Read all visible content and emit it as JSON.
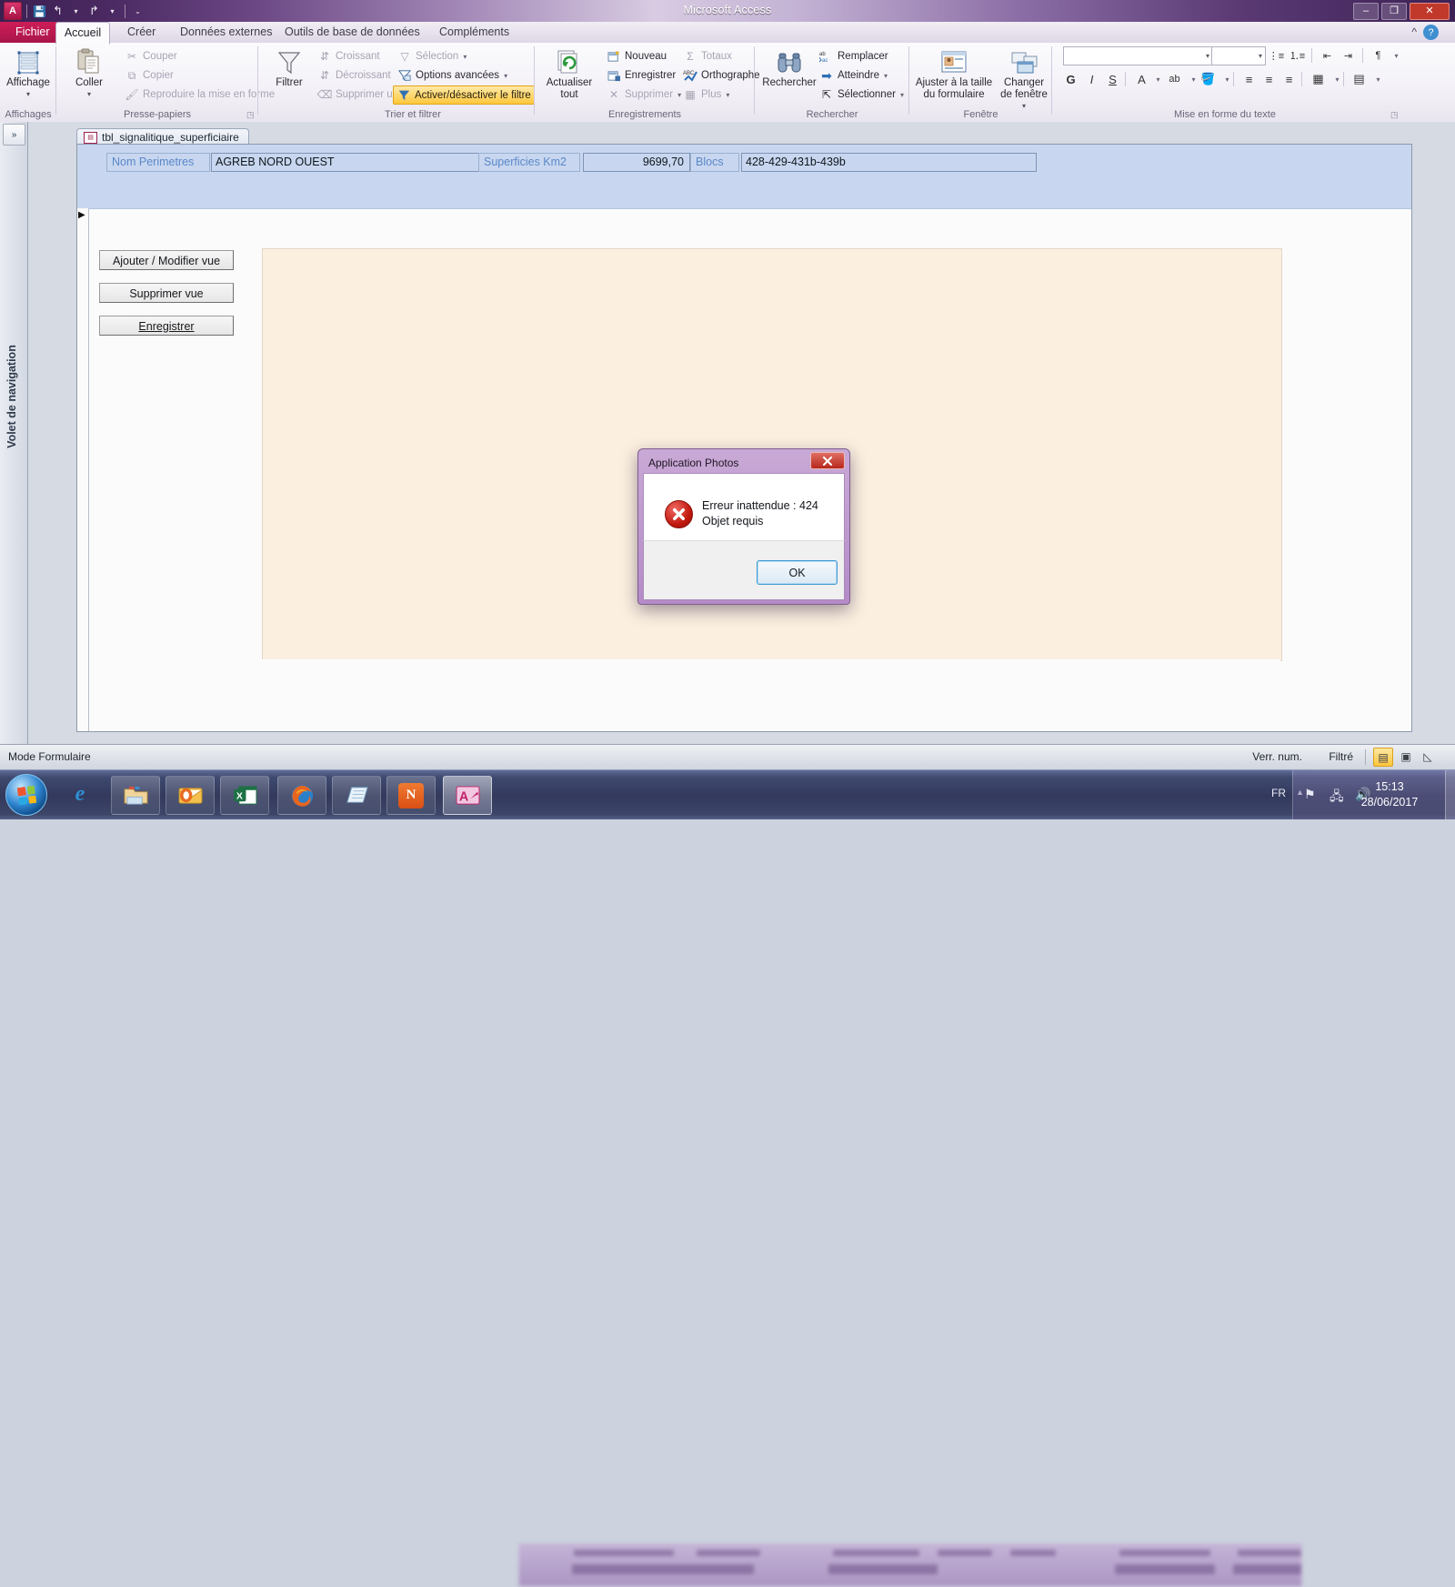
{
  "window": {
    "title": "Microsoft Access",
    "minimize_label": "–",
    "maximize_label": "❐",
    "close_label": "✕",
    "help_label": "?",
    "ribbon_collapse_label": "^"
  },
  "quick_access": {
    "office_logo": "A",
    "save_label": "💾",
    "undo_label": "↰",
    "redo_label": "↱",
    "customize_label": "▾"
  },
  "tabs": [
    {
      "label": "Fichier",
      "type": "file"
    },
    {
      "label": "Accueil",
      "type": "active"
    },
    {
      "label": "Créer",
      "type": "normal"
    },
    {
      "label": "Données externes",
      "type": "normal"
    },
    {
      "label": "Outils de base de données",
      "type": "normal"
    },
    {
      "label": "Compléments",
      "type": "normal"
    }
  ],
  "ribbon": {
    "groups": [
      {
        "name": "Affichages",
        "title": "Affichages"
      },
      {
        "name": "Presse-papiers",
        "title": "Presse-papiers"
      },
      {
        "name": "Trier et filtrer",
        "title": "Trier et filtrer"
      },
      {
        "name": "Enregistrements",
        "title": "Enregistrements"
      },
      {
        "name": "Rechercher",
        "title": "Rechercher"
      },
      {
        "name": "Fenêtre",
        "title": "Fenêtre"
      },
      {
        "name": "Mise en forme du texte",
        "title": "Mise en forme du texte"
      }
    ],
    "affichage_label": "Affichage",
    "coller_label": "Coller",
    "couper_label": "Couper",
    "copier_label": "Copier",
    "reproduire_label": "Reproduire la mise en forme",
    "filtrer_label": "Filtrer",
    "croissant_label": "Croissant",
    "decroissant_label": "Décroissant",
    "supprimer_tri_label": "Supprimer un tri",
    "selection_label": "Sélection",
    "options_avancees_label": "Options avancées",
    "activer_filtre_label": "Activer/désactiver le filtre",
    "actualiser_label": "Actualiser tout",
    "nouveau_label": "Nouveau",
    "enregistrer_label": "Enregistrer",
    "supprimer_label": "Supprimer",
    "totaux_label": "Totaux",
    "orthographe_label": "Orthographe",
    "plus_label": "Plus",
    "rechercher_label": "Rechercher",
    "remplacer_label": "Remplacer",
    "atteindre_label": "Atteindre",
    "selectionner_label": "Sélectionner",
    "ajuster_taille_label": "Ajuster à la taille du formulaire",
    "changer_fenetre_label": "Changer de fenêtre",
    "bold_label": "G",
    "italic_label": "I",
    "underline_label": "S",
    "font_color_label": "A",
    "highlight_label": "ab",
    "fill_label": "🪣",
    "align_left_label": "≡",
    "align_center_label": "≡",
    "align_right_label": "≡",
    "grid_label": "▦",
    "alt_fill_label": "▤",
    "bullets_label": "⋮≡",
    "numbering_label": "⒈≡",
    "indent_dec_label": "⇤",
    "indent_inc_label": "⇥",
    "rtl_label": "¶",
    "font_name_value": "",
    "font_size_value": ""
  },
  "nav_pane": {
    "label": "Volet de navigation",
    "expand_label": "»"
  },
  "document": {
    "tab_label": "tbl_signalitique_superficiaire",
    "close_label": "✕",
    "record_marker": "▶",
    "fields": [
      {
        "label": "Nom Perimetres",
        "value": "AGREB NORD OUEST",
        "align": "left"
      },
      {
        "label": "Superficies Km2",
        "value": "9699,70",
        "align": "right"
      },
      {
        "label": "Blocs",
        "value": "428-429-431b-439b",
        "align": "left"
      }
    ],
    "buttons": [
      {
        "label": "Ajouter / Modifier vue",
        "accel": ""
      },
      {
        "label": "Supprimer vue",
        "accel": ""
      },
      {
        "label": "Enregistrer",
        "accel": "E"
      }
    ]
  },
  "dialog": {
    "title": "Application Photos",
    "close_label": "✕",
    "icon": "error-icon",
    "icon_glyph": "✕",
    "message_line1": "Erreur inattendue : 424",
    "message_line2": "Objet requis",
    "ok_label": "OK"
  },
  "status_bar": {
    "mode": "Mode Formulaire",
    "num_lock": "Verr. num.",
    "filter": "Filtré",
    "view_form_label": "▤",
    "view_layout_label": "▣",
    "view_design_label": "◺"
  },
  "taskbar": {
    "start_label": "start",
    "items": [
      {
        "name": "internet-explorer",
        "glyph": "e",
        "color": "#1c78c0",
        "active": false,
        "plain": true
      },
      {
        "name": "windows-explorer",
        "glyph": "🗀",
        "color": "#e8b53c",
        "active": false,
        "plain": false
      },
      {
        "name": "outlook",
        "glyph": "O",
        "color": "#e8a33d",
        "active": false,
        "plain": false
      },
      {
        "name": "excel",
        "glyph": "X",
        "color": "#1e7145",
        "active": false,
        "plain": false
      },
      {
        "name": "firefox",
        "glyph": "🦊",
        "color": "#e36b20",
        "active": false,
        "plain": false
      },
      {
        "name": "notepad",
        "glyph": "📄",
        "color": "#8fb6d8",
        "active": false,
        "plain": false
      },
      {
        "name": "nitro-pdf",
        "glyph": "N",
        "color": "#e8622a",
        "active": false,
        "plain": false
      },
      {
        "name": "access",
        "glyph": "A",
        "color": "#c0246b",
        "active": true,
        "plain": false
      }
    ],
    "language": "FR",
    "time": "15:13",
    "date": "28/06/2017",
    "tray_up_label": "▲",
    "flag_label": "⚑",
    "network_label": "🖧",
    "volume_label": "🔊"
  },
  "colors": {
    "accent": "#a8164a",
    "ribbon_highlight": "#ffc83d",
    "form_header": "#c8d7ef",
    "photo_panel": "#fbefdf",
    "dialog_chrome": "#b48bc7",
    "error_red": "#c0170e"
  }
}
